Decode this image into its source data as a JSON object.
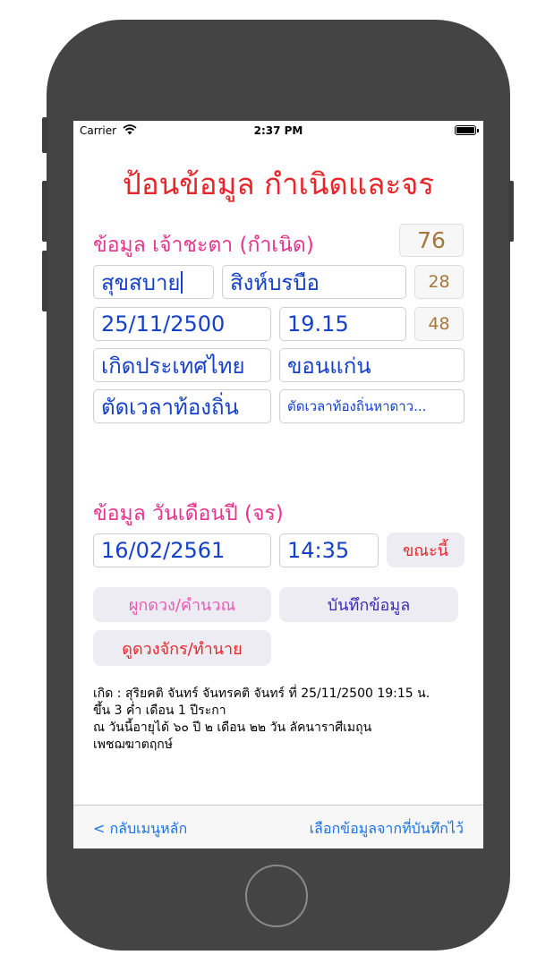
{
  "status_bar": {
    "carrier": "Carrier",
    "time": "2:37 PM"
  },
  "title": "ป้อนข้อมูล กำเนิดและจร",
  "birth_section": {
    "label": "ข้อมูล เจ้าชะตา (กำเนิด)",
    "number_1": "76",
    "first_name": "สุขสบาย",
    "last_name": "สิงห์บรบือ",
    "number_2": "28",
    "birth_date": "25/11/2500",
    "birth_time": "19.15",
    "number_3": "48",
    "country": "เกิดประเทศไทย",
    "province": "ขอนแก่น",
    "local_time_option": "ตัดเวลาท้องถิ่น",
    "local_time_detail": "ตัดเวลาท้องถิ่นหาดาว..."
  },
  "transit_section": {
    "label": "ข้อมูล วันเดือนปี (จร)",
    "date": "16/02/2561",
    "time": "14:35",
    "now_button": "ขณะนี้"
  },
  "buttons": {
    "compute": "ผูกดวง/คำนวณ",
    "save": "บันทึกข้อมูล",
    "predict": "ดูดวงจักร/ทำนาย"
  },
  "result_lines": [
    "เกิด : สุริยคติ จันทร์ จันทรคติ จันทร์ ที่ 25/11/2500 19:15 น.",
    "ขึ้น 3 ค่ำ เดือน 1 ปีระกา",
    "ณ วันนี้อายุได้ ๖๐ ปี ๒ เดือน ๒๒ วัน ลัคนาราศีเมถุน",
    "เพชฌฆาตฤกษ์"
  ],
  "toolbar": {
    "back": "< กลับเมนูหลัก",
    "select_saved": "เลือกข้อมูลจากที่บันทึกไว้"
  },
  "colors": {
    "title_red": "#e8262b",
    "section_pink": "#e8338f",
    "field_blue": "#1540c8",
    "number_brown": "#a5773d",
    "toolbar_link": "#1a73e8"
  }
}
